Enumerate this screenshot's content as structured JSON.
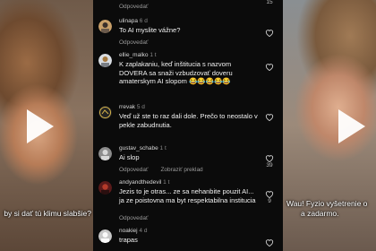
{
  "left_video": {
    "caption": "by si dať tú klimu slabšie?"
  },
  "right_video": {
    "caption_line1": "Wau! Fyzio vyšetrenie o",
    "caption_line2": "a zadarmo."
  },
  "comments": [
    {
      "username": "",
      "age": "",
      "text": "",
      "reply": "Odpovedať",
      "likes": "15"
    },
    {
      "username": "ulinapa",
      "age": "6 d",
      "text": "To AI myslite vážne?",
      "reply": "Odpovedať",
      "likes": ""
    },
    {
      "username": "ellie_malko",
      "age": "1 t",
      "text": "K zaplakaniu, keď inštitucia s nazvom DOVERA sa snaži vzbudzovať doveru amaterskym AI slopom 😂😂😂😂😂",
      "reply": "Odpovedať",
      "likes": ""
    },
    {
      "username": "rrevak",
      "age": "5 d",
      "text": "Veď už ste to raz dali dole. Prečo to neostalo v pekle zabudnutia.",
      "reply": "Odpovedať",
      "likes": ""
    },
    {
      "username": "gustav_schabe",
      "age": "1 t",
      "text": "Ai slop",
      "reply": "Odpovedať",
      "translate": "Zobraziť preklad",
      "likes": "39"
    },
    {
      "username": "andyandthedevil",
      "age": "1 t",
      "text": "Jezis to je otras... ze sa nehanbite pouzit AI... ja ze poistovna ma byt respektabilna institucia",
      "reply": "Odpovedať",
      "likes": "9"
    },
    {
      "username": "noakiej",
      "age": "4 d",
      "text": "trapas",
      "reply": "",
      "likes": ""
    }
  ],
  "colors": {
    "panel_bg": "#0b0b0b",
    "text": "#f2f2f2",
    "muted": "#9a9a9a"
  },
  "icons": {
    "like": "heart-outline-icon",
    "play": "play-triangle-icon"
  }
}
